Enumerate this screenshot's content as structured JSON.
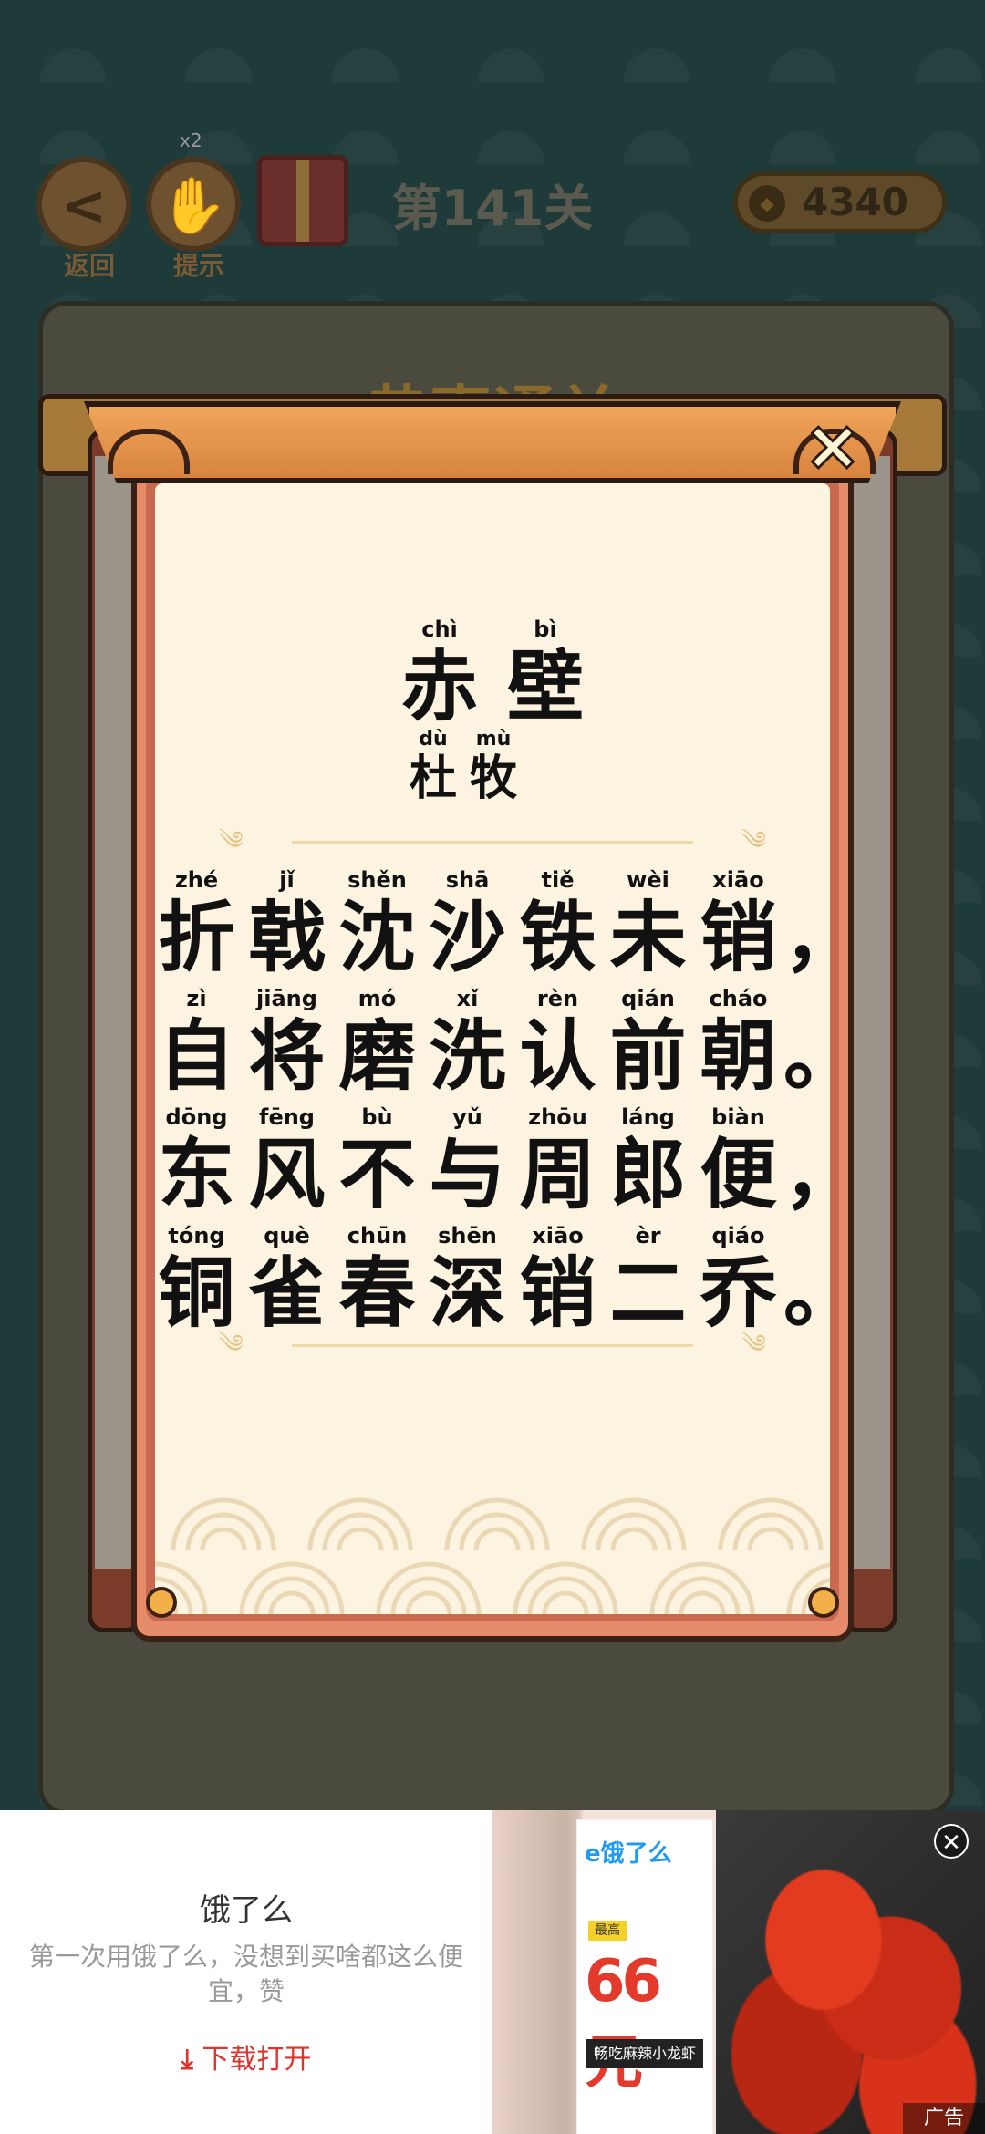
{
  "topbar": {
    "back_label": "返回",
    "hint_label": "提示",
    "hint_count": "x2",
    "level": "第141关",
    "coins": "4340"
  },
  "board": {
    "title": "恭喜通关"
  },
  "poem": {
    "title": [
      {
        "py": "chì",
        "hz": "赤"
      },
      {
        "py": "bì",
        "hz": "壁"
      }
    ],
    "author": [
      {
        "py": "dù",
        "hz": "杜"
      },
      {
        "py": "mù",
        "hz": "牧"
      }
    ],
    "lines": [
      {
        "chars": [
          {
            "py": "zhé",
            "hz": "折"
          },
          {
            "py": "jǐ",
            "hz": "戟"
          },
          {
            "py": "shěn",
            "hz": "沈"
          },
          {
            "py": "shā",
            "hz": "沙"
          },
          {
            "py": "tiě",
            "hz": "铁"
          },
          {
            "py": "wèi",
            "hz": "未"
          },
          {
            "py": "xiāo",
            "hz": "销"
          }
        ],
        "punct": "，"
      },
      {
        "chars": [
          {
            "py": "zì",
            "hz": "自"
          },
          {
            "py": "jiāng",
            "hz": "将"
          },
          {
            "py": "mó",
            "hz": "磨"
          },
          {
            "py": "xǐ",
            "hz": "洗"
          },
          {
            "py": "rèn",
            "hz": "认"
          },
          {
            "py": "qián",
            "hz": "前"
          },
          {
            "py": "cháo",
            "hz": "朝"
          }
        ],
        "punct": "。"
      },
      {
        "chars": [
          {
            "py": "dōng",
            "hz": "东"
          },
          {
            "py": "fēng",
            "hz": "风"
          },
          {
            "py": "bù",
            "hz": "不"
          },
          {
            "py": "yǔ",
            "hz": "与"
          },
          {
            "py": "zhōu",
            "hz": "周"
          },
          {
            "py": "láng",
            "hz": "郎"
          },
          {
            "py": "biàn",
            "hz": "便"
          }
        ],
        "punct": "，"
      },
      {
        "chars": [
          {
            "py": "tóng",
            "hz": "铜"
          },
          {
            "py": "què",
            "hz": "雀"
          },
          {
            "py": "chūn",
            "hz": "春"
          },
          {
            "py": "shēn",
            "hz": "深"
          },
          {
            "py": "xiāo",
            "hz": "销"
          },
          {
            "py": "èr",
            "hz": "二"
          },
          {
            "py": "qiáo",
            "hz": "乔"
          }
        ],
        "punct": "。"
      }
    ]
  },
  "popup": {
    "close": "✕"
  },
  "ad": {
    "title": "饿了么",
    "description": "第一次用饿了么，没想到买啥都这么便宜，赞",
    "download": "下载打开",
    "download_icon": "download-arrow-icon",
    "card_brand": "e饿了么",
    "card_tag": "最高",
    "card_price": "66元",
    "card_sub": "畅吃麻辣小龙虾",
    "close": "✕",
    "label": "广告"
  }
}
